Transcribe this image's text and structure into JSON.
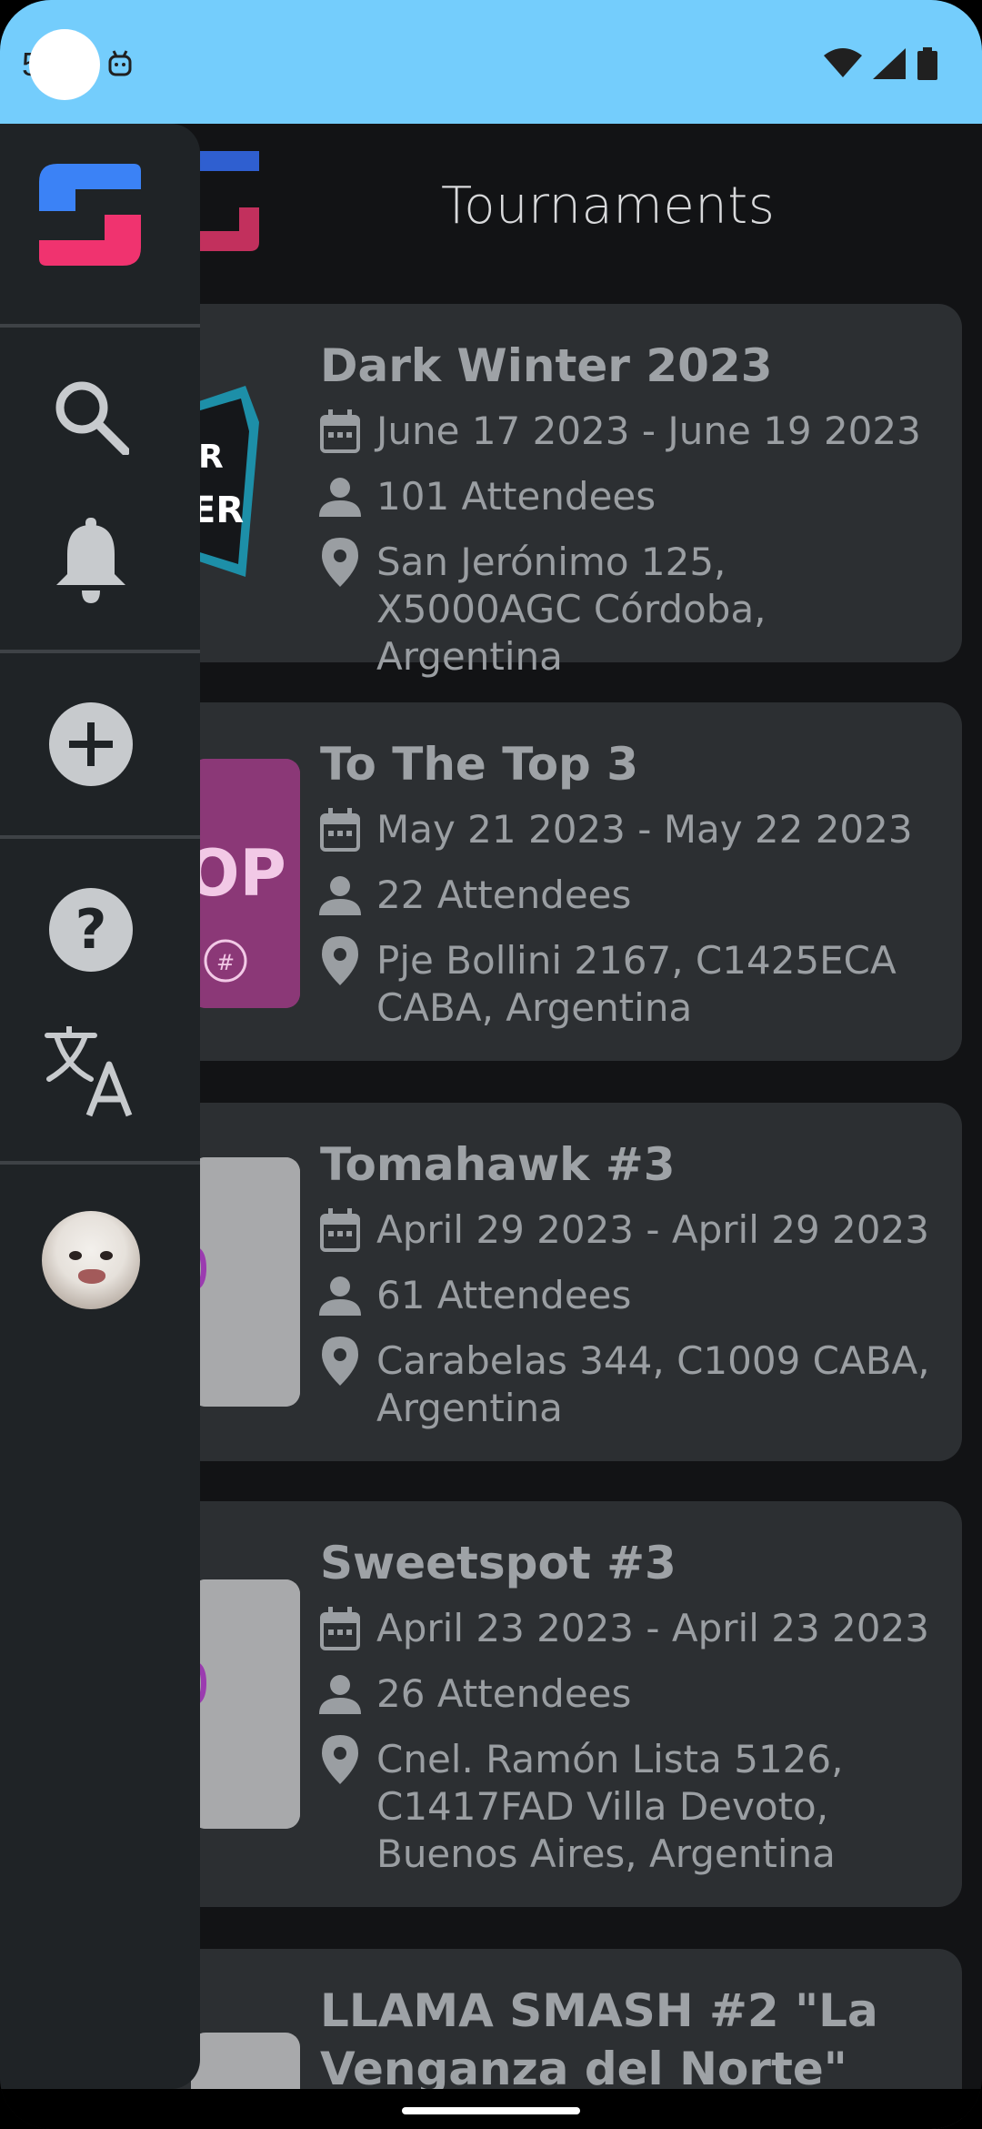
{
  "status_bar": {
    "time": "5",
    "background": "#74cdfc"
  },
  "app_bar": {
    "title": "Tournaments"
  },
  "nav_rail": {
    "items": [
      {
        "icon": "app-logo-icon"
      },
      {
        "icon": "search-icon"
      },
      {
        "icon": "bell-icon"
      },
      {
        "icon": "add-circle-icon"
      },
      {
        "icon": "help-circle-icon"
      },
      {
        "icon": "translate-icon"
      },
      {
        "icon": "avatar"
      }
    ]
  },
  "tournaments": [
    {
      "name": "Dark Winter 2023",
      "dates": "June 17 2023 - June 19 2023",
      "attendees": "101 Attendees",
      "location": "San Jerónimo 125, X5000AGC Córdoba, Argentina"
    },
    {
      "name": "To The Top 3",
      "dates": "May 21 2023 - May 22 2023",
      "attendees": "22 Attendees",
      "location": "Pje Bollini 2167, C1425ECA CABA, Argentina"
    },
    {
      "name": "Tomahawk #3",
      "dates": "April 29 2023 - April 29 2023",
      "attendees": "61 Attendees",
      "location": "Carabelas 344, C1009 CABA, Argentina"
    },
    {
      "name": "Sweetspot #3",
      "dates": "April 23 2023 - April 23 2023",
      "attendees": "26 Attendees",
      "location": "Cnel. Ramón Lista 5126, C1417FAD Villa Devoto, Buenos Aires, Argentina"
    },
    {
      "name": "LLAMA SMASH #2 \"La Venganza del Norte\""
    }
  ],
  "colors": {
    "accent_blue": "#3b82f6",
    "accent_pink": "#f0336f",
    "background": "#121315",
    "card": "#2c2f32",
    "rail": "#1f2326"
  }
}
